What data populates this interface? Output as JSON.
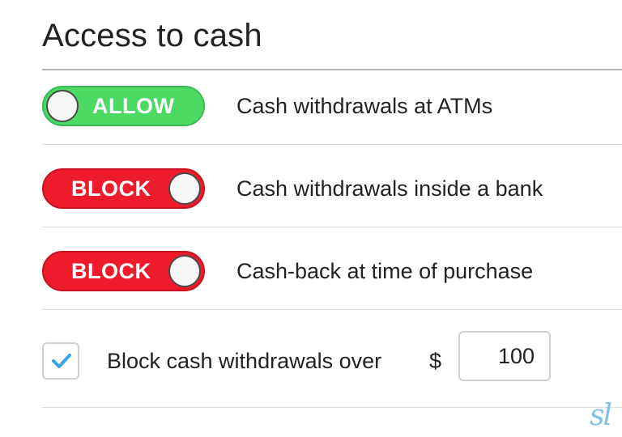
{
  "section": {
    "title": "Access to cash"
  },
  "rows": [
    {
      "state": "ALLOW",
      "label": "Cash withdrawals at ATMs"
    },
    {
      "state": "BLOCK",
      "label": "Cash withdrawals inside a bank"
    },
    {
      "state": "BLOCK",
      "label": "Cash-back at time of purchase"
    }
  ],
  "limit": {
    "checked": true,
    "label": "Block cash withdrawals over",
    "currency": "$",
    "amount": "100"
  },
  "logo": {
    "text": "sl"
  },
  "colors": {
    "allow": "#4cd964",
    "block": "#ee1c2b",
    "check": "#3aa6e0",
    "logo": "#7fc0e6"
  }
}
